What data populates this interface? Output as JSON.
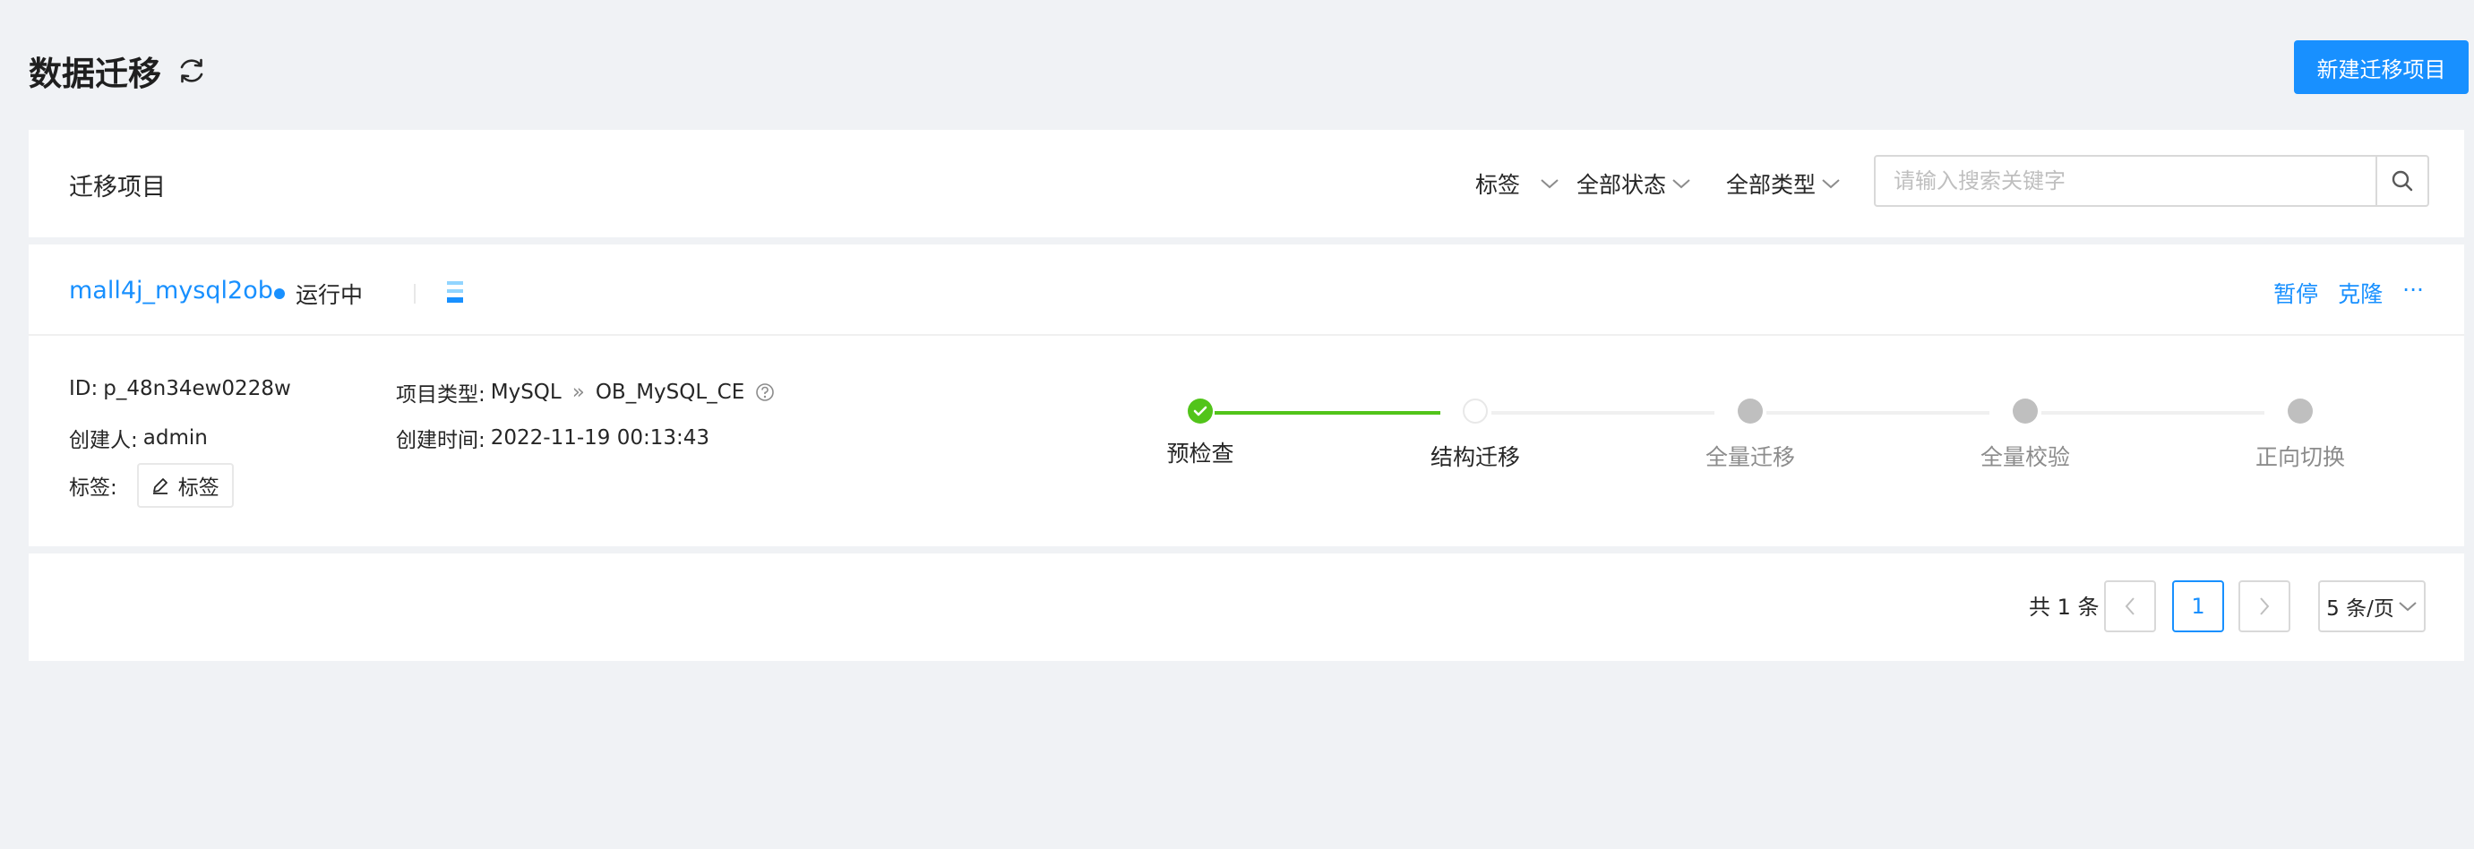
{
  "header": {
    "title": "数据迁移",
    "new_button": "新建迁移项目"
  },
  "toolbar": {
    "section_title": "迁移项目",
    "filters": [
      "标签",
      "全部状态",
      "全部类型"
    ],
    "search_placeholder": "请输入搜索关键字"
  },
  "project": {
    "name": "mall4j_mysql2ob",
    "status": "运行中",
    "actions": [
      "暂停",
      "克隆",
      "···"
    ],
    "id_label": "ID: ",
    "id_value": "p_48n34ew0228w",
    "creator_label": "创建人: ",
    "creator_value": "admin",
    "tag_label": "标签:",
    "tag_button": "标签",
    "type_label": "项目类型: ",
    "type_source": "MySQL",
    "type_arrow": "»",
    "type_target": "OB_MySQL_CE",
    "created_label": "创建时间: ",
    "created_value": "2022-11-19 00:13:43",
    "steps": [
      {
        "label": "预检查",
        "state": "done"
      },
      {
        "label": "结构迁移",
        "state": "current"
      },
      {
        "label": "全量迁移",
        "state": "pending"
      },
      {
        "label": "全量校验",
        "state": "pending"
      },
      {
        "label": "正向切换",
        "state": "pending"
      }
    ]
  },
  "pagination": {
    "total": "共 1 条",
    "current_page": "1",
    "page_size": "5 条/页"
  },
  "colors": {
    "primary": "#1890ff",
    "success": "#52c41a",
    "pending": "#bfbfbf"
  }
}
